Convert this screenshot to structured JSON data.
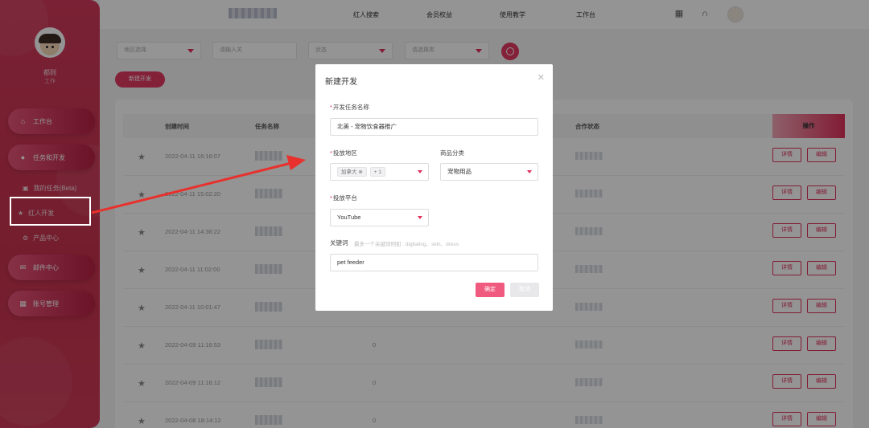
{
  "sidebar": {
    "user_name": "都则",
    "user_role": "工作",
    "items": [
      {
        "label": "工作台",
        "icon": "home-icon"
      },
      {
        "label": "任务和开发",
        "icon": "user-icon"
      },
      {
        "label": "我的任务(Beta)",
        "icon": "lock-icon"
      },
      {
        "label": "红人开发",
        "icon": "star-icon"
      },
      {
        "label": "产品中心",
        "icon": "gear-icon"
      },
      {
        "label": "邮件中心",
        "icon": "mail-icon"
      },
      {
        "label": "账号管理",
        "icon": "grid-icon"
      }
    ]
  },
  "header": {
    "nav": [
      "红人搜索",
      "会员权益",
      "使用教学",
      "工作台"
    ]
  },
  "filters": {
    "f1": "地区选择",
    "f2": "请输入关",
    "f3": "状态",
    "f4": "请选择类"
  },
  "toolbar": {
    "new_label": "新建开发"
  },
  "table": {
    "headers": [
      "创建时间",
      "任务名称",
      "合作状态",
      "操作"
    ],
    "view_label": "详情",
    "edit_label": "编辑",
    "rows": [
      {
        "date": "2022-04-11 16:16:07",
        "num": ""
      },
      {
        "date": "2022-04-11 15:02:20",
        "num": ""
      },
      {
        "date": "2022-04-11 14:36:22",
        "num": ""
      },
      {
        "date": "2022-04-11 11:02:00",
        "num": ""
      },
      {
        "date": "2022-04-11 10:01:47",
        "num": ""
      },
      {
        "date": "2022-04-09 11:16:53",
        "num": "0"
      },
      {
        "date": "2022-04-09 11:16:12",
        "num": "0"
      },
      {
        "date": "2022-04-08 18:14:12",
        "num": "0"
      }
    ]
  },
  "modal": {
    "title": "新建开发",
    "task_name_label": "开发任务名称",
    "task_name_value": "北美 - 宠物饮食器推广",
    "region_label": "投放地区",
    "region_tag": "加拿大",
    "region_more": "+ 1",
    "category_label": "商品分类",
    "category_value": "宠物用品",
    "platform_label": "投放平台",
    "platform_value": "YouTube",
    "keyword_label": "关键词",
    "keyword_hint": "最多一个关键词例如 : digitaling、skin、dress",
    "keyword_value": "pet feeder",
    "ok_label": "确定",
    "cancel_label": "取消"
  },
  "colors": {
    "accent": "#e23a62",
    "sidebar": "#d23a5c",
    "arrow": "#e8302c"
  }
}
